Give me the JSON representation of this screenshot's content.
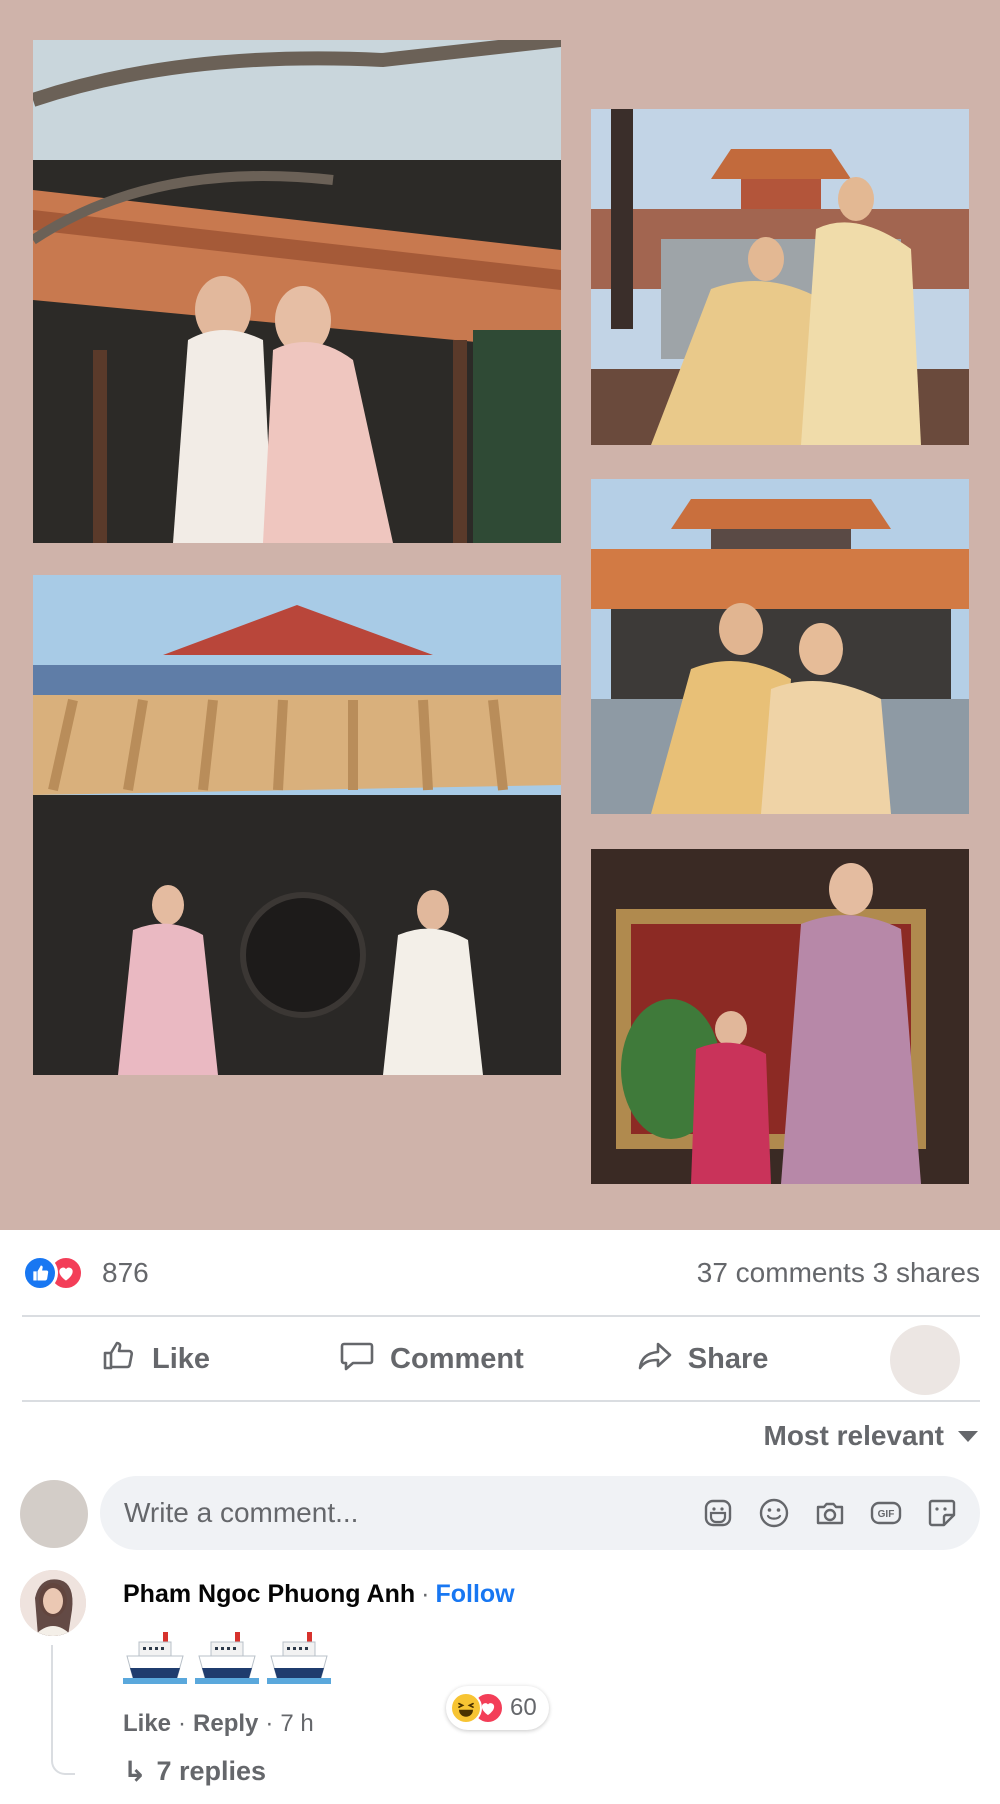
{
  "post": {
    "reaction_count": "876",
    "comments_shares": "37 comments  3 shares",
    "reaction_types": [
      "like",
      "love"
    ]
  },
  "actions": {
    "like": "Like",
    "comment": "Comment",
    "share": "Share"
  },
  "filter": {
    "label": "Most relevant"
  },
  "composer": {
    "placeholder": "Write a comment...",
    "icons": [
      "avatar-sticker-icon",
      "emoji-icon",
      "camera-icon",
      "gif-icon",
      "sticker-icon"
    ]
  },
  "comment": {
    "author": "Pham Ngoc Phuong Anh",
    "separator": "·",
    "follow": "Follow",
    "body_emojis": [
      "ship",
      "ship",
      "ship"
    ],
    "meta": {
      "like": "Like",
      "reply": "Reply",
      "time": "7 h"
    },
    "reaction_count": "60",
    "reaction_types": [
      "haha",
      "love"
    ],
    "replies": "7 replies"
  },
  "colors": {
    "collage_bg": "#cfb3aa",
    "accent": "#1877f2",
    "love": "#f33e58",
    "muted_text": "#65676b"
  }
}
